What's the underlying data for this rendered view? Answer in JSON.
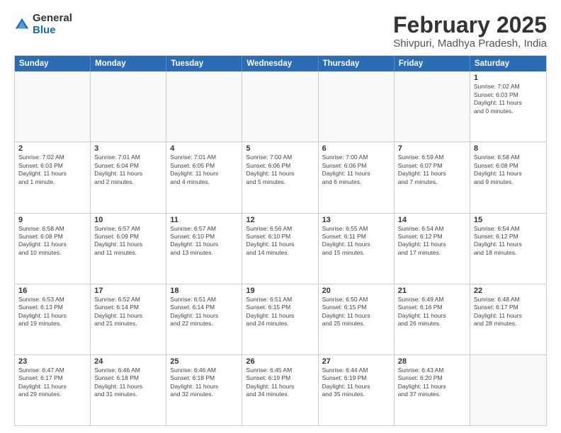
{
  "logo": {
    "general": "General",
    "blue": "Blue"
  },
  "header": {
    "month": "February 2025",
    "location": "Shivpuri, Madhya Pradesh, India"
  },
  "weekdays": [
    "Sunday",
    "Monday",
    "Tuesday",
    "Wednesday",
    "Thursday",
    "Friday",
    "Saturday"
  ],
  "rows": [
    [
      {
        "day": "",
        "info": ""
      },
      {
        "day": "",
        "info": ""
      },
      {
        "day": "",
        "info": ""
      },
      {
        "day": "",
        "info": ""
      },
      {
        "day": "",
        "info": ""
      },
      {
        "day": "",
        "info": ""
      },
      {
        "day": "1",
        "info": "Sunrise: 7:02 AM\nSunset: 6:03 PM\nDaylight: 11 hours\nand 0 minutes."
      }
    ],
    [
      {
        "day": "2",
        "info": "Sunrise: 7:02 AM\nSunset: 6:03 PM\nDaylight: 11 hours\nand 1 minute."
      },
      {
        "day": "3",
        "info": "Sunrise: 7:01 AM\nSunset: 6:04 PM\nDaylight: 11 hours\nand 2 minutes."
      },
      {
        "day": "4",
        "info": "Sunrise: 7:01 AM\nSunset: 6:05 PM\nDaylight: 11 hours\nand 4 minutes."
      },
      {
        "day": "5",
        "info": "Sunrise: 7:00 AM\nSunset: 6:06 PM\nDaylight: 11 hours\nand 5 minutes."
      },
      {
        "day": "6",
        "info": "Sunrise: 7:00 AM\nSunset: 6:06 PM\nDaylight: 11 hours\nand 6 minutes."
      },
      {
        "day": "7",
        "info": "Sunrise: 6:59 AM\nSunset: 6:07 PM\nDaylight: 11 hours\nand 7 minutes."
      },
      {
        "day": "8",
        "info": "Sunrise: 6:58 AM\nSunset: 6:08 PM\nDaylight: 11 hours\nand 9 minutes."
      }
    ],
    [
      {
        "day": "9",
        "info": "Sunrise: 6:58 AM\nSunset: 6:08 PM\nDaylight: 11 hours\nand 10 minutes."
      },
      {
        "day": "10",
        "info": "Sunrise: 6:57 AM\nSunset: 6:09 PM\nDaylight: 11 hours\nand 11 minutes."
      },
      {
        "day": "11",
        "info": "Sunrise: 6:57 AM\nSunset: 6:10 PM\nDaylight: 11 hours\nand 13 minutes."
      },
      {
        "day": "12",
        "info": "Sunrise: 6:56 AM\nSunset: 6:10 PM\nDaylight: 11 hours\nand 14 minutes."
      },
      {
        "day": "13",
        "info": "Sunrise: 6:55 AM\nSunset: 6:11 PM\nDaylight: 11 hours\nand 15 minutes."
      },
      {
        "day": "14",
        "info": "Sunrise: 6:54 AM\nSunset: 6:12 PM\nDaylight: 11 hours\nand 17 minutes."
      },
      {
        "day": "15",
        "info": "Sunrise: 6:54 AM\nSunset: 6:12 PM\nDaylight: 11 hours\nand 18 minutes."
      }
    ],
    [
      {
        "day": "16",
        "info": "Sunrise: 6:53 AM\nSunset: 6:13 PM\nDaylight: 11 hours\nand 19 minutes."
      },
      {
        "day": "17",
        "info": "Sunrise: 6:52 AM\nSunset: 6:14 PM\nDaylight: 11 hours\nand 21 minutes."
      },
      {
        "day": "18",
        "info": "Sunrise: 6:51 AM\nSunset: 6:14 PM\nDaylight: 11 hours\nand 22 minutes."
      },
      {
        "day": "19",
        "info": "Sunrise: 6:51 AM\nSunset: 6:15 PM\nDaylight: 11 hours\nand 24 minutes."
      },
      {
        "day": "20",
        "info": "Sunrise: 6:50 AM\nSunset: 6:15 PM\nDaylight: 11 hours\nand 25 minutes."
      },
      {
        "day": "21",
        "info": "Sunrise: 6:49 AM\nSunset: 6:16 PM\nDaylight: 11 hours\nand 26 minutes."
      },
      {
        "day": "22",
        "info": "Sunrise: 6:48 AM\nSunset: 6:17 PM\nDaylight: 11 hours\nand 28 minutes."
      }
    ],
    [
      {
        "day": "23",
        "info": "Sunrise: 6:47 AM\nSunset: 6:17 PM\nDaylight: 11 hours\nand 29 minutes."
      },
      {
        "day": "24",
        "info": "Sunrise: 6:46 AM\nSunset: 6:18 PM\nDaylight: 11 hours\nand 31 minutes."
      },
      {
        "day": "25",
        "info": "Sunrise: 6:46 AM\nSunset: 6:18 PM\nDaylight: 11 hours\nand 32 minutes."
      },
      {
        "day": "26",
        "info": "Sunrise: 6:45 AM\nSunset: 6:19 PM\nDaylight: 11 hours\nand 34 minutes."
      },
      {
        "day": "27",
        "info": "Sunrise: 6:44 AM\nSunset: 6:19 PM\nDaylight: 11 hours\nand 35 minutes."
      },
      {
        "day": "28",
        "info": "Sunrise: 6:43 AM\nSunset: 6:20 PM\nDaylight: 11 hours\nand 37 minutes."
      },
      {
        "day": "",
        "info": ""
      }
    ]
  ]
}
